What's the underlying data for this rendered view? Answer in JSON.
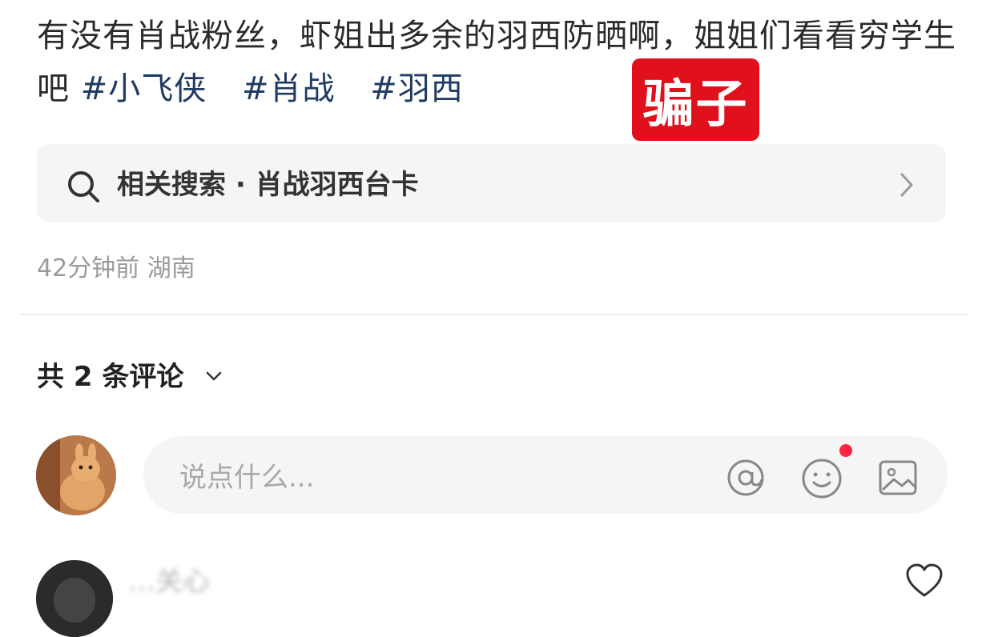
{
  "post": {
    "text": "有没有肖战粉丝，虾姐出多余的羽西防晒啊，姐姐们看看穷学生吧 ",
    "tags": [
      "#小飞侠",
      "#肖战",
      "#羽西"
    ]
  },
  "stamp": {
    "text": "骗子",
    "color": "#e0101c"
  },
  "related_search": {
    "label": "相关搜索 · 肖战羽西台卡",
    "icon": "search-icon"
  },
  "meta": {
    "time_location": "42分钟前 湖南"
  },
  "comments": {
    "count_label": "共 2 条评论",
    "input_placeholder": "说点什么...",
    "first_commenter_name": "…关心"
  },
  "colors": {
    "accent_red": "#ff2442",
    "tag_blue": "#1f3b63"
  }
}
